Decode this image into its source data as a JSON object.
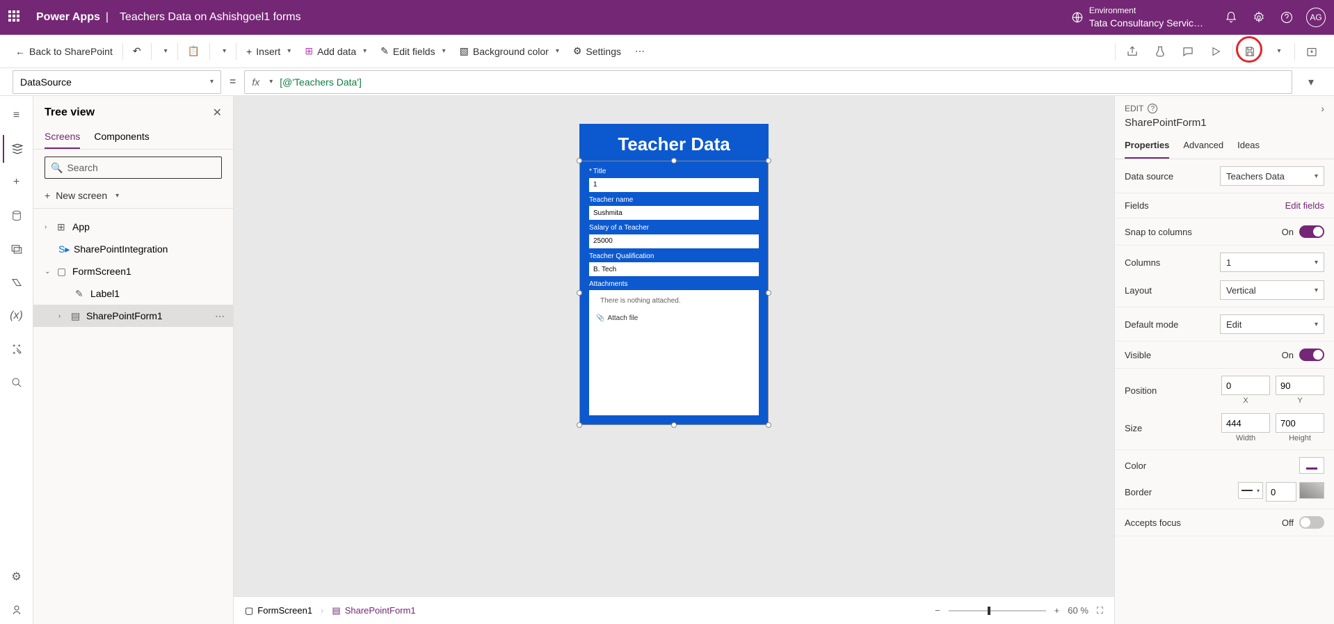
{
  "header": {
    "app": "Power Apps",
    "title": "Teachers Data on Ashishgoel1 forms",
    "env_label": "Environment",
    "env_name": "Tata Consultancy Servic…",
    "avatar": "AG"
  },
  "toolbar": {
    "back": "Back to SharePoint",
    "insert": "Insert",
    "add_data": "Add data",
    "edit_fields": "Edit fields",
    "bg_color": "Background color",
    "settings": "Settings"
  },
  "formula": {
    "property": "DataSource",
    "fx": "fx",
    "value": "[@'Teachers Data']"
  },
  "tree": {
    "title": "Tree view",
    "tabs": {
      "screens": "Screens",
      "components": "Components"
    },
    "search_placeholder": "Search",
    "new_screen": "New screen",
    "items": {
      "app": "App",
      "spi": "SharePointIntegration",
      "form_screen": "FormScreen1",
      "label1": "Label1",
      "sp_form": "SharePointForm1"
    }
  },
  "canvas": {
    "title": "Teacher Data",
    "fields": {
      "title_label": "Title",
      "title_value": "1",
      "name_label": "Teacher name",
      "name_value": "Sushmita",
      "salary_label": "Salary of a Teacher",
      "salary_value": "25000",
      "qual_label": "Teacher Qualification",
      "qual_value": "B. Tech",
      "attach_label": "Attachments",
      "attach_empty": "There is nothing attached.",
      "attach_file": "Attach file"
    }
  },
  "breadcrumb": {
    "screen": "FormScreen1",
    "form": "SharePointForm1",
    "zoom": "60 %"
  },
  "props": {
    "edit": "EDIT",
    "name": "SharePointForm1",
    "tabs": {
      "properties": "Properties",
      "advanced": "Advanced",
      "ideas": "Ideas"
    },
    "data_source": "Data source",
    "data_source_val": "Teachers Data",
    "fields": "Fields",
    "edit_fields": "Edit fields",
    "snap": "Snap to columns",
    "on": "On",
    "off": "Off",
    "columns": "Columns",
    "columns_val": "1",
    "layout": "Layout",
    "layout_val": "Vertical",
    "default_mode": "Default mode",
    "default_mode_val": "Edit",
    "visible": "Visible",
    "position": "Position",
    "pos_x": "0",
    "pos_y": "90",
    "x_lbl": "X",
    "y_lbl": "Y",
    "size": "Size",
    "width": "444",
    "height": "700",
    "width_lbl": "Width",
    "height_lbl": "Height",
    "color": "Color",
    "border": "Border",
    "border_val": "0",
    "accepts_focus": "Accepts focus"
  }
}
